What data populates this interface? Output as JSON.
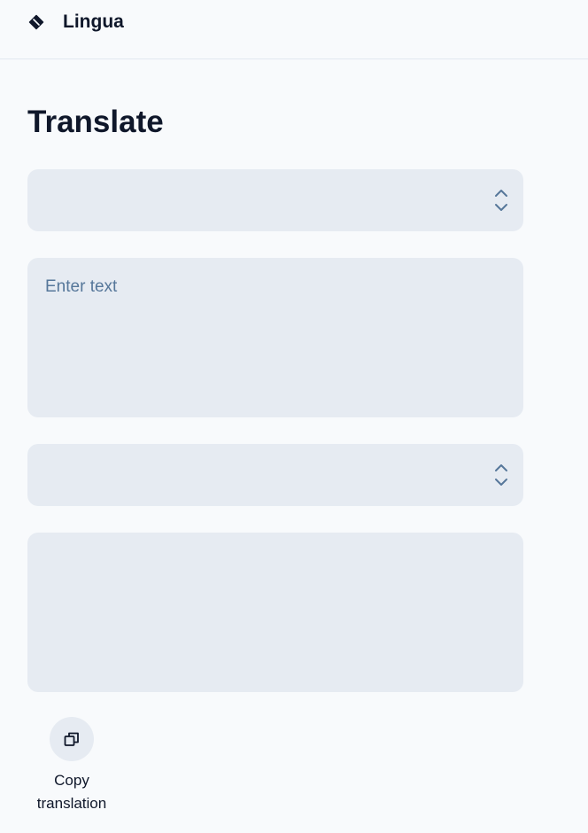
{
  "app": {
    "name": "Lingua",
    "logo_icon": "tag-icon"
  },
  "page": {
    "title": "Translate"
  },
  "source_language": {
    "selected": "",
    "icon": "chevron-up-down-icon"
  },
  "source_text": {
    "value": "",
    "placeholder": "Enter text"
  },
  "target_language": {
    "selected": "",
    "icon": "chevron-up-down-icon"
  },
  "translation": {
    "value": ""
  },
  "copy": {
    "label": "Copy translation",
    "icon": "copy-icon"
  },
  "colors": {
    "background": "#f8fafc",
    "field_background": "#e6ebf2",
    "text": "#0f172a",
    "accent": "#56779a",
    "divider": "#e2e8f0"
  }
}
